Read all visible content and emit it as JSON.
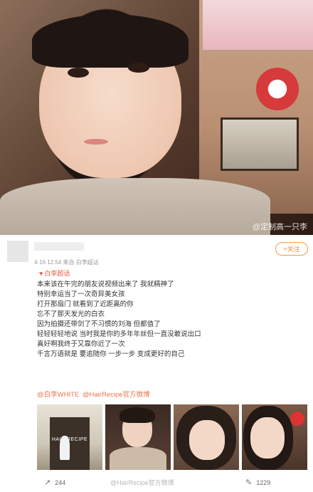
{
  "post": {
    "photo_watermark": "@定制高一只李",
    "meta": "4-16 12:54  来自 白李超话",
    "follow_label": "+关注",
    "topic_label": "白李超话",
    "lines": [
      "本来该在午完的朋友说视频出来了 我就精神了",
      "特别幸运当了一次奇异美女孩",
      "打开那扇门 就看到了近距离的你",
      "忘不了那天发光的白衣",
      "因为拍摄还带剑了不习惯的刘海 但都值了",
      "轻轻轻轻地说 当时我是你的多年年丝但一直没敢说出口",
      "真好啊我终于又靠你近了一次",
      "千言万语就是 要追随你 一步一步 变成更好的自己"
    ],
    "mentions": [
      "@白李WHITE",
      "@HairRecipe官方微博"
    ],
    "thumb1_label": "HAIR RECIPE",
    "share_count": "244",
    "comment_count": "1229",
    "footer_watermark": "@HairRecipe官方微博"
  },
  "colors": {
    "accent": "#eb7350",
    "follow": "#f08a2e"
  },
  "icons": [
    "share-icon",
    "comment-icon",
    "tag-icon"
  ]
}
